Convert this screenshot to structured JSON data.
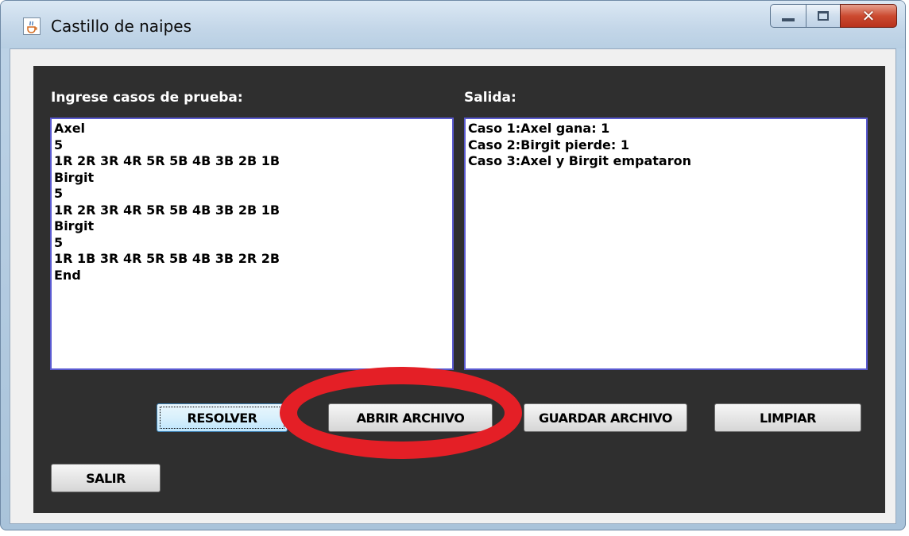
{
  "window": {
    "title": "Castillo de naipes",
    "icon": "java-cup-icon",
    "controls": {
      "minimize": "minimize-icon",
      "maximize": "maximize-icon",
      "close": "close-icon"
    }
  },
  "input": {
    "label": "Ingrese casos de prueba:",
    "value": "Axel\n5\n1R 2R 3R 4R 5R 5B 4B 3B 2B 1B\nBirgit\n5\n1R 2R 3R 4R 5R 5B 4B 3B 2B 1B\nBirgit\n5\n1R 1B 3R 4R 5R 5B 4B 3B 2R 2B\nEnd"
  },
  "output": {
    "label": "Salida:",
    "value": "Caso 1:Axel gana: 1\nCaso 2:Birgit pierde: 1\nCaso 3:Axel y Birgit empataron"
  },
  "buttons": {
    "resolver": "RESOLVER",
    "abrir": "ABRIR ARCHIVO",
    "guardar": "GUARDAR ARCHIVO",
    "limpiar": "LIMPIAR",
    "salir": "SALIR"
  },
  "annotation": {
    "shape": "ellipse",
    "color": "#e41f26",
    "target": "abrir-archivo-button"
  },
  "colors": {
    "panel_bg": "#2f2f2f",
    "textarea_border": "#5a5ad0",
    "label_text": "#ffffff"
  }
}
